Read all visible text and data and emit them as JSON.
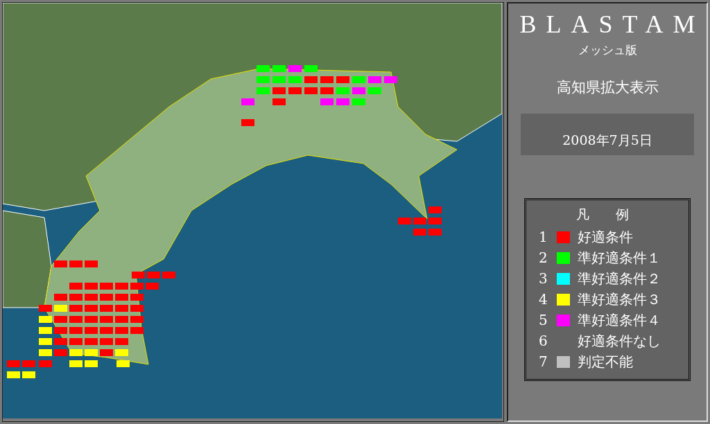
{
  "sidebar": {
    "title": "BLASTAM",
    "subtitle": "メッシュ版",
    "region": "高知県拡大表示",
    "date": "2008年7月5日"
  },
  "legend": {
    "title": "凡　　例",
    "items": [
      {
        "number": "1",
        "label": "好適条件",
        "color": "#ff0000"
      },
      {
        "number": "2",
        "label": "準好適条件１",
        "color": "#00ff00"
      },
      {
        "number": "3",
        "label": "準好適条件２",
        "color": "#00ffff"
      },
      {
        "number": "4",
        "label": "準好適条件３",
        "color": "#ffff00"
      },
      {
        "number": "5",
        "label": "準好適条件４",
        "color": "#ff00ff"
      },
      {
        "number": "6",
        "label": "好適条件なし"
      },
      {
        "number": "7",
        "label": "判定不能",
        "color": "#c0c0c0"
      }
    ]
  }
}
